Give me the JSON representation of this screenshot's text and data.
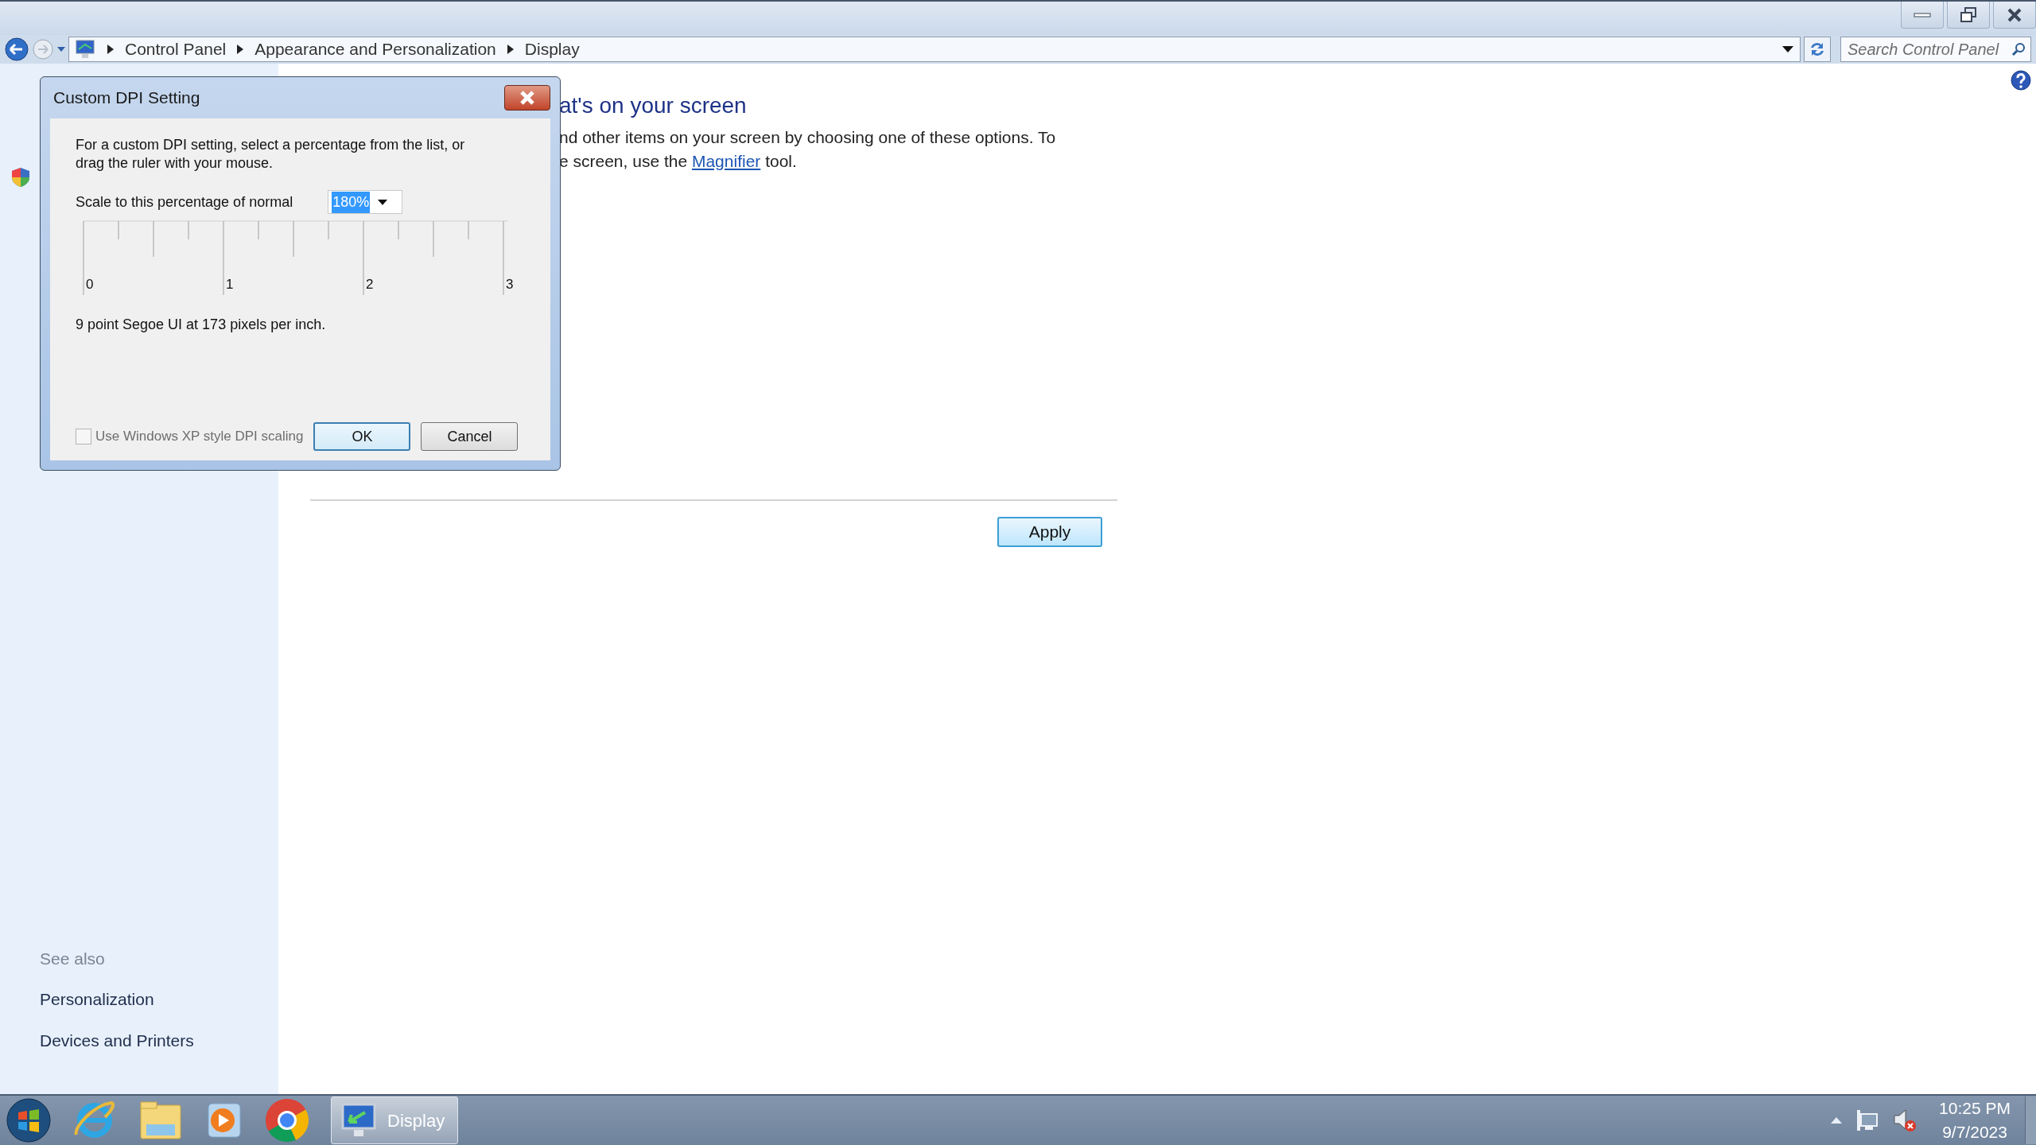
{
  "address_bar": {
    "breadcrumbs": [
      "Control Panel",
      "Appearance and Personalization",
      "Display"
    ],
    "search": {
      "placeholder": "Search Control Panel"
    }
  },
  "main": {
    "heading": "at's on your screen",
    "description_line_1": "nd other items on your screen by choosing one of these options. To",
    "description_line_2": {
      "before": "e screen, use the ",
      "link": "Magnifier",
      "after": " tool."
    },
    "apply_button": "Apply"
  },
  "sidebar": {
    "see_also_heading": "See also",
    "links": [
      "Personalization",
      "Devices and Printers"
    ]
  },
  "dialog": {
    "title": "Custom DPI Setting",
    "instructions": "For a custom DPI setting, select a percentage from the list, or drag the ruler with your mouse.",
    "scale_label": "Scale to this percentage of normal",
    "scale_value": {
      "text": "180%",
      "text_selected": true
    },
    "ruler_labels": [
      "0",
      "1",
      "2",
      "3"
    ],
    "sample_text": "9 point Segoe UI at 173 pixels per inch.",
    "xp_scaling": {
      "label": "Use Windows XP style DPI scaling",
      "checked": false,
      "disabled": true
    },
    "buttons": [
      {
        "label": "OK",
        "default": true
      },
      {
        "label": "Cancel",
        "default": false
      }
    ]
  },
  "taskbar": {
    "buttons": [
      {
        "label": "Display",
        "active": true
      }
    ],
    "clock": {
      "time": "10:25 PM",
      "date": "9/7/2023"
    }
  }
}
